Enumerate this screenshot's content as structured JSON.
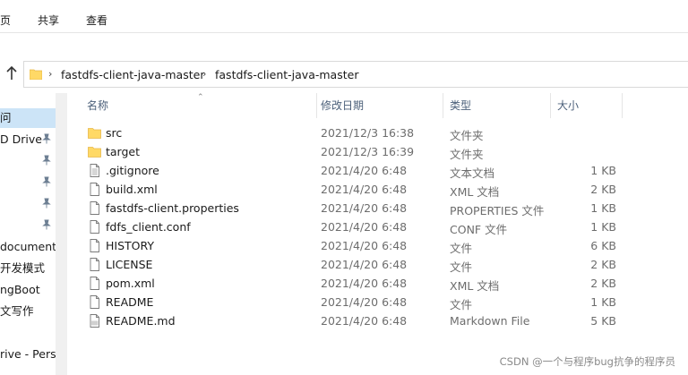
{
  "ribbon": {
    "tabs": [
      "页",
      "共享",
      "查看"
    ]
  },
  "address": {
    "crumbs": [
      "fastdfs-client-java-master",
      "fastdfs-client-java-master"
    ]
  },
  "nav": {
    "items": [
      {
        "label": "问",
        "selected": true,
        "pinned": false
      },
      {
        "label": "D Drive",
        "selected": false,
        "pinned": true
      },
      {
        "label": "",
        "selected": false,
        "pinned": true
      },
      {
        "label": "",
        "selected": false,
        "pinned": true
      },
      {
        "label": "",
        "selected": false,
        "pinned": true
      },
      {
        "label": "",
        "selected": false,
        "pinned": true
      },
      {
        "label": "document",
        "selected": false,
        "pinned": false
      },
      {
        "label": "开发模式",
        "selected": false,
        "pinned": false
      },
      {
        "label": "ngBoot",
        "selected": false,
        "pinned": false
      },
      {
        "label": "文写作",
        "selected": false,
        "pinned": false
      },
      {
        "label": "",
        "selected": false,
        "pinned": false
      },
      {
        "label": "rive - Perso",
        "selected": false,
        "pinned": false
      }
    ]
  },
  "columns": {
    "name": "名称",
    "date": "修改日期",
    "type": "类型",
    "size": "大小"
  },
  "files": [
    {
      "name": "src",
      "date": "2021/12/3 16:38",
      "type": "文件夹",
      "size": "",
      "icon": "folder"
    },
    {
      "name": "target",
      "date": "2021/12/3 16:39",
      "type": "文件夹",
      "size": "",
      "icon": "folder"
    },
    {
      "name": ".gitignore",
      "date": "2021/4/20 6:48",
      "type": "文本文档",
      "size": "1 KB",
      "icon": "text"
    },
    {
      "name": "build.xml",
      "date": "2021/4/20 6:48",
      "type": "XML 文档",
      "size": "2 KB",
      "icon": "file"
    },
    {
      "name": "fastdfs-client.properties",
      "date": "2021/4/20 6:48",
      "type": "PROPERTIES 文件",
      "size": "1 KB",
      "icon": "file"
    },
    {
      "name": "fdfs_client.conf",
      "date": "2021/4/20 6:48",
      "type": "CONF 文件",
      "size": "1 KB",
      "icon": "file"
    },
    {
      "name": "HISTORY",
      "date": "2021/4/20 6:48",
      "type": "文件",
      "size": "6 KB",
      "icon": "file"
    },
    {
      "name": "LICENSE",
      "date": "2021/4/20 6:48",
      "type": "文件",
      "size": "2 KB",
      "icon": "file"
    },
    {
      "name": "pom.xml",
      "date": "2021/4/20 6:48",
      "type": "XML 文档",
      "size": "2 KB",
      "icon": "file"
    },
    {
      "name": "README",
      "date": "2021/4/20 6:48",
      "type": "文件",
      "size": "1 KB",
      "icon": "file"
    },
    {
      "name": "README.md",
      "date": "2021/4/20 6:48",
      "type": "Markdown File",
      "size": "5 KB",
      "icon": "markdown"
    }
  ],
  "watermark": "CSDN @一个与程序bug抗争的程序员",
  "colors": {
    "folder": "#ffd966",
    "folder_dark": "#e8b84a",
    "selection": "#cce4f7",
    "header_text": "#4c607a"
  }
}
